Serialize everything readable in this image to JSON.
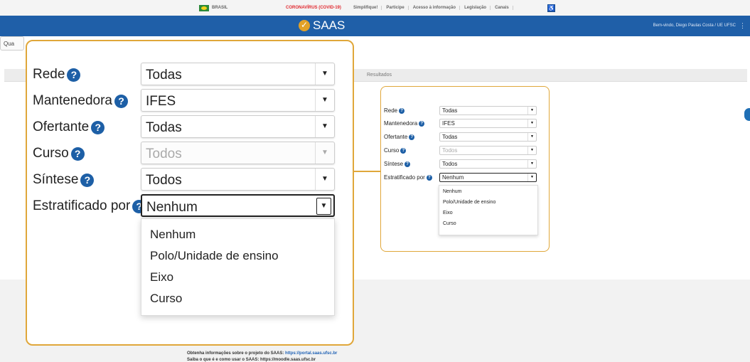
{
  "gov_bar": {
    "brasil": "BRASIL",
    "covid": "CORONAVÍRUS (COVID-19)",
    "links": [
      "Simplifique!",
      "Participe",
      "Acesso à informação",
      "Legislação",
      "Canais"
    ]
  },
  "header": {
    "logo": "SAAS",
    "user": "Bem-vindo, Diego Paulas Costa / UE UFSC"
  },
  "tabs": {
    "first": "Qua"
  },
  "results_label": "Resultados",
  "filters": {
    "rede": {
      "label": "Rede",
      "value": "Todas"
    },
    "mantenedora": {
      "label": "Mantenedora",
      "value": "IFES"
    },
    "ofertante": {
      "label": "Ofertante",
      "value": "Todas"
    },
    "curso": {
      "label": "Curso",
      "value": "Todos"
    },
    "sintese": {
      "label": "Síntese",
      "value": "Todos"
    },
    "estratificado": {
      "label": "Estratificado por",
      "value": "Nenhum"
    }
  },
  "dropdown_options": [
    "Nenhum",
    "Polo/Unidade de ensino",
    "Eixo",
    "Curso"
  ],
  "footer": {
    "line1_label": "Obtenha informações sobre o projeto do SAAS:",
    "line1_link": "https://portal.saas.ufsc.br",
    "line2_label": "Saiba o que é e como usar o SAAS:",
    "line2_link": "https://moodle.saas.ufsc.br"
  },
  "colors": {
    "header": "#1f5fa8",
    "callout_border": "#e0a73a",
    "help_icon": "#1d5fa6"
  }
}
